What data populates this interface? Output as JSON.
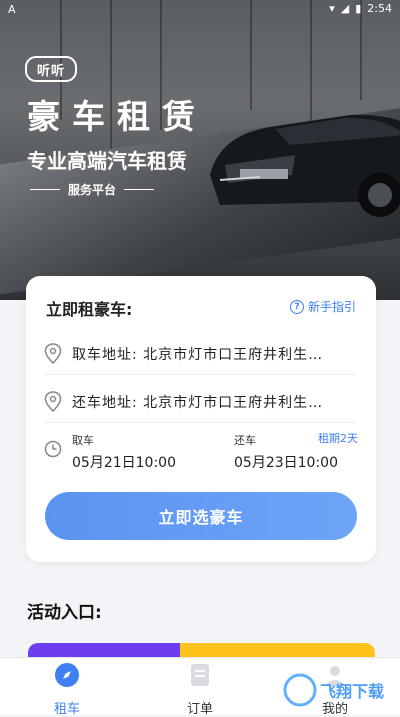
{
  "status_bar": {
    "left_icon": "A",
    "time": "2:54"
  },
  "hero": {
    "logo_text": "听听",
    "title": "豪车租赁",
    "subtitle": "专业高端汽车租赁",
    "tag": "服务平台"
  },
  "booking": {
    "title": "立即租豪车:",
    "guide_label": "新手指引",
    "pickup": "取车地址: 北京市灯市口王府井利生…",
    "return": "还车地址: 北京市灯市口王府井利生…",
    "pickup_time_label": "取车",
    "pickup_time": "05月21日10:00",
    "return_time_label": "还车",
    "return_time": "05月23日10:00",
    "duration": "租期2天",
    "cta": "立即选豪车"
  },
  "activity": {
    "title": "活动入口:"
  },
  "tabbar": {
    "items": [
      {
        "label": "租车",
        "icon": "compass-icon"
      },
      {
        "label": "订单",
        "icon": "document-icon"
      },
      {
        "label": "我的",
        "icon": "user-icon"
      }
    ]
  },
  "watermark": "飞翔下载",
  "colors": {
    "accent": "#3d7ff5",
    "cta": "#5b93f2",
    "banner_purple": "#6c3ef0",
    "banner_yellow": "#ffc21a"
  }
}
